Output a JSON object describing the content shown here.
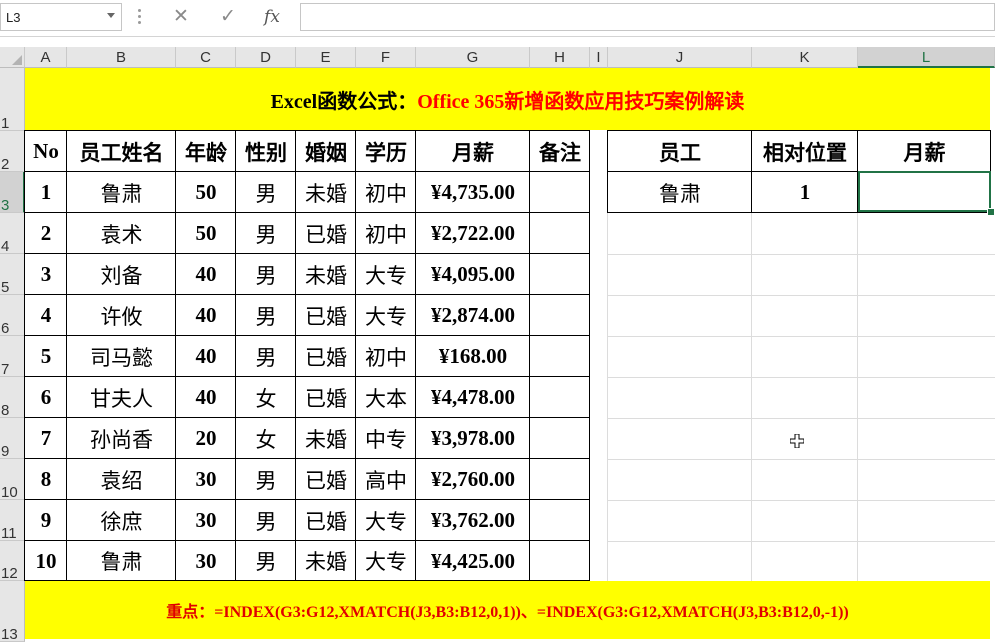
{
  "formula_bar": {
    "name_box": "L3",
    "fx_label": "fx",
    "cancel_glyph": "✕",
    "enter_glyph": "✓",
    "formula": ""
  },
  "columns": [
    "A",
    "B",
    "C",
    "D",
    "E",
    "F",
    "G",
    "H",
    "I",
    "J",
    "K",
    "L"
  ],
  "rows": [
    "1",
    "2",
    "3",
    "4",
    "5",
    "6",
    "7",
    "8",
    "9",
    "10",
    "11",
    "12",
    "13"
  ],
  "title": {
    "part1": "Excel函数公式：",
    "part2": "Office 365新增函数应用技巧案例解读"
  },
  "table": {
    "headers": [
      "No",
      "员工姓名",
      "年龄",
      "性别",
      "婚姻",
      "学历",
      "月薪",
      "备注"
    ],
    "rows": [
      [
        "1",
        "鲁肃",
        "50",
        "男",
        "未婚",
        "初中",
        "¥4,735.00",
        ""
      ],
      [
        "2",
        "袁术",
        "50",
        "男",
        "已婚",
        "初中",
        "¥2,722.00",
        ""
      ],
      [
        "3",
        "刘备",
        "40",
        "男",
        "未婚",
        "大专",
        "¥4,095.00",
        ""
      ],
      [
        "4",
        "许攸",
        "40",
        "男",
        "已婚",
        "大专",
        "¥2,874.00",
        ""
      ],
      [
        "5",
        "司马懿",
        "40",
        "男",
        "已婚",
        "初中",
        "¥168.00",
        ""
      ],
      [
        "6",
        "甘夫人",
        "40",
        "女",
        "已婚",
        "大本",
        "¥4,478.00",
        ""
      ],
      [
        "7",
        "孙尚香",
        "20",
        "女",
        "未婚",
        "中专",
        "¥3,978.00",
        ""
      ],
      [
        "8",
        "袁绍",
        "30",
        "男",
        "已婚",
        "高中",
        "¥2,760.00",
        ""
      ],
      [
        "9",
        "徐庶",
        "30",
        "男",
        "已婚",
        "大专",
        "¥3,762.00",
        ""
      ],
      [
        "10",
        "鲁肃",
        "30",
        "男",
        "未婚",
        "大专",
        "¥4,425.00",
        ""
      ]
    ]
  },
  "lookup": {
    "headers": [
      "员工",
      "相对位置",
      "月薪"
    ],
    "row": [
      "鲁肃",
      "1",
      ""
    ]
  },
  "footer": {
    "label": "重点：",
    "text": "=INDEX(G3:G12,XMATCH(J3,B3:B12,0,1))、=INDEX(G3:G12,XMATCH(J3,B3:B12,0,-1))"
  },
  "colors": {
    "banner": "#ffff00",
    "title_red": "#ff0000",
    "excel_green": "#217346"
  }
}
